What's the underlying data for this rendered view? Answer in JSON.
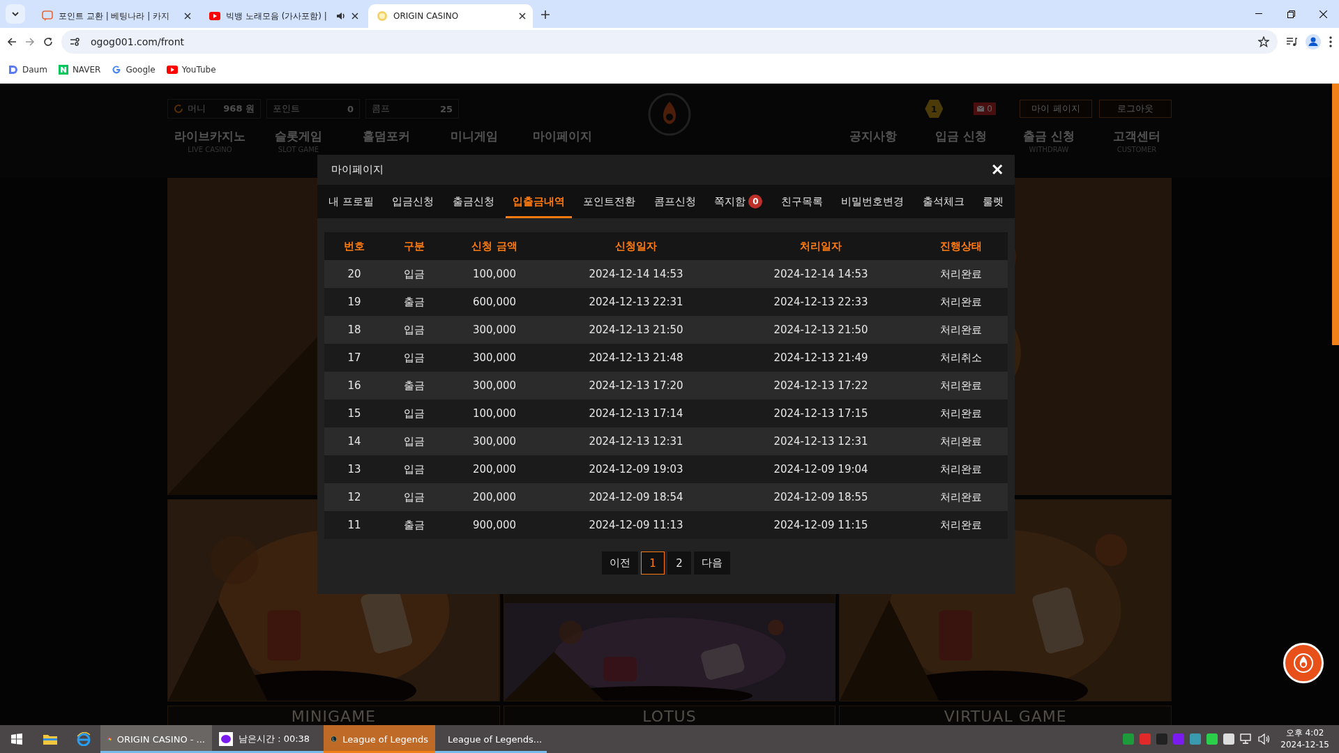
{
  "browser": {
    "tabs": [
      {
        "title": "포인트 교환 | 베팅나라 | 카지",
        "kind": "chat",
        "audio": false,
        "selected": false
      },
      {
        "title": "빅뱅 노래모음 (가사포함) |",
        "kind": "video",
        "audio": true,
        "selected": false
      },
      {
        "title": "ORIGIN CASINO",
        "kind": "site",
        "audio": false,
        "selected": true
      }
    ],
    "address": "ogog001.com/front",
    "bookmarks": [
      {
        "label": "Daum",
        "kind": "portal"
      },
      {
        "label": "NAVER",
        "kind": "search"
      },
      {
        "label": "Google",
        "kind": "engine"
      },
      {
        "label": "YouTube",
        "kind": "video"
      }
    ]
  },
  "site": {
    "stats": [
      {
        "label": "머니",
        "value": "968 원",
        "kind": "money"
      },
      {
        "label": "포인트",
        "value": "0",
        "kind": "plain"
      },
      {
        "label": "콤프",
        "value": "25",
        "kind": "plain"
      }
    ],
    "level": "1",
    "mail_count": "0",
    "buttons": [
      "마이 페이지",
      "로그아웃"
    ],
    "nav_left": [
      {
        "label": "라이브카지노",
        "sub": "LIVE CASINO"
      },
      {
        "label": "슬롯게임",
        "sub": "SLOT GAME"
      },
      {
        "label": "홀덤포커"
      },
      {
        "label": "미니게임"
      },
      {
        "label": "마이페이지"
      }
    ],
    "nav_right": [
      {
        "label": "공지사항"
      },
      {
        "label": "입금 신청"
      },
      {
        "label": "출금 신청",
        "sub": "WITHDRAW"
      },
      {
        "label": "고객센터",
        "sub": "CUSTOMER"
      }
    ],
    "sections": [
      "MINIGAME",
      "LOTUS",
      "VIRTUAL GAME"
    ]
  },
  "modal": {
    "title": "마이페이지",
    "close": "✕",
    "tabs": [
      {
        "label": "내 프로필",
        "selected": false
      },
      {
        "label": "입금신청",
        "selected": false
      },
      {
        "label": "출금신청",
        "selected": false
      },
      {
        "label": "입출금내역",
        "selected": true
      },
      {
        "label": "포인트전환",
        "selected": false
      },
      {
        "label": "콤프신청",
        "selected": false
      },
      {
        "label": "쪽지함",
        "selected": false,
        "badge": "0"
      },
      {
        "label": "친구목록",
        "selected": false
      },
      {
        "label": "비밀번호변경",
        "selected": false
      },
      {
        "label": "출석체크",
        "selected": false
      },
      {
        "label": "룰렛",
        "selected": false
      }
    ],
    "table": {
      "columns": [
        "번호",
        "구분",
        "신청 금액",
        "신청일자",
        "처리일자",
        "진행상태"
      ],
      "rows": [
        [
          "20",
          "입금",
          "100,000",
          "2024-12-14 14:53",
          "2024-12-14 14:53",
          "처리완료"
        ],
        [
          "19",
          "출금",
          "600,000",
          "2024-12-13 22:31",
          "2024-12-13 22:33",
          "처리완료"
        ],
        [
          "18",
          "입금",
          "300,000",
          "2024-12-13 21:50",
          "2024-12-13 21:50",
          "처리완료"
        ],
        [
          "17",
          "입금",
          "300,000",
          "2024-12-13 21:48",
          "2024-12-13 21:49",
          "처리취소"
        ],
        [
          "16",
          "출금",
          "300,000",
          "2024-12-13 17:20",
          "2024-12-13 17:22",
          "처리완료"
        ],
        [
          "15",
          "입금",
          "100,000",
          "2024-12-13 17:14",
          "2024-12-13 17:15",
          "처리완료"
        ],
        [
          "14",
          "입금",
          "300,000",
          "2024-12-13 12:31",
          "2024-12-13 12:31",
          "처리완료"
        ],
        [
          "13",
          "입금",
          "200,000",
          "2024-12-09 19:03",
          "2024-12-09 19:04",
          "처리완료"
        ],
        [
          "12",
          "입금",
          "200,000",
          "2024-12-09 18:54",
          "2024-12-09 18:55",
          "처리완료"
        ],
        [
          "11",
          "출금",
          "900,000",
          "2024-12-09 11:13",
          "2024-12-09 11:15",
          "처리완료"
        ]
      ]
    },
    "pagination": [
      {
        "label": "이전",
        "selected": false
      },
      {
        "label": "1",
        "selected": true
      },
      {
        "label": "2",
        "selected": false
      },
      {
        "label": "다음",
        "selected": false
      }
    ]
  },
  "taskbar": {
    "apps": [
      {
        "label": "ORIGIN CASINO - ...",
        "kind": "browser",
        "focused": true,
        "flashing": false
      },
      {
        "label": "남은시간 : 00:38",
        "kind": "timer",
        "focused": false,
        "flashing": false
      },
      {
        "label": "League of Legends",
        "kind": "game",
        "focused": false,
        "flashing": true
      },
      {
        "label": "League of Legends...",
        "kind": "game",
        "focused": false,
        "flashing": false
      }
    ],
    "time": "오후 4:02",
    "date": "2024-12-15"
  }
}
